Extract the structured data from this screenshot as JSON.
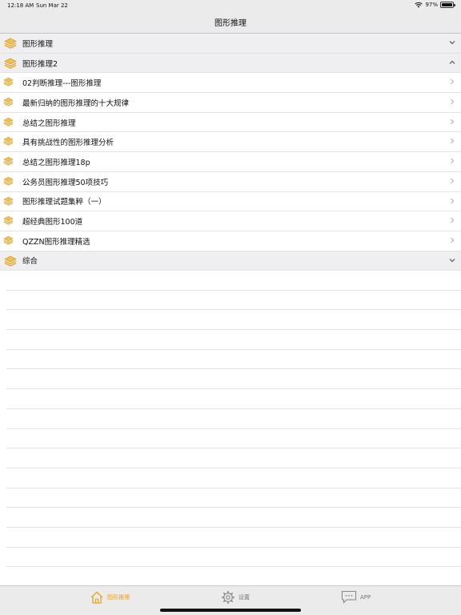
{
  "status": {
    "time": "12:18 AM",
    "date": "Sun Mar 22",
    "battery": "97%",
    "battery_level": 0.97
  },
  "nav": {
    "title": "图形推理"
  },
  "sections": [
    {
      "label": "图形推理",
      "expanded": false
    },
    {
      "label": "图形推理2",
      "expanded": true
    },
    {
      "label": "综合",
      "expanded": false
    }
  ],
  "items": [
    {
      "label": "02判断推理---图形推理"
    },
    {
      "label": "最新归纳的图形推理的十大规律"
    },
    {
      "label": "总结之图形推理"
    },
    {
      "label": "具有挑战性的图形推理分析"
    },
    {
      "label": "总结之图形推理18p"
    },
    {
      "label": "公务员图形推理50项技巧"
    },
    {
      "label": "图形推理试题集粹（一）"
    },
    {
      "label": "超经典图形100道"
    },
    {
      "label": "QZZN图形推理精选"
    }
  ],
  "tabs": [
    {
      "label": "图形推理",
      "icon": "home-icon",
      "active": true
    },
    {
      "label": "设置",
      "icon": "gear-icon",
      "active": false
    },
    {
      "label": "APP",
      "icon": "chat-bubble-icon",
      "active": false
    }
  ],
  "colors": {
    "accent": "#f0a020",
    "icon_gold": "#f3b23a",
    "section_bg": "#efeff1",
    "bar_bg": "#ebebeb"
  }
}
